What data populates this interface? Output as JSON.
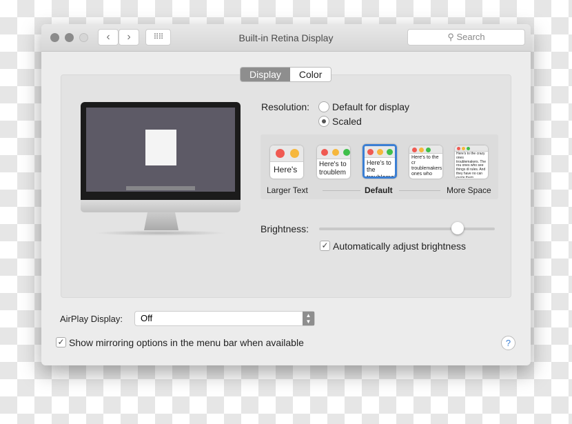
{
  "window": {
    "title": "Built-in Retina Display",
    "search_placeholder": "Search"
  },
  "tabs": [
    {
      "label": "Display",
      "selected": true
    },
    {
      "label": "Color",
      "selected": false
    }
  ],
  "resolution": {
    "label": "Resolution:",
    "options": [
      {
        "label": "Default for display",
        "selected": false
      },
      {
        "label": "Scaled",
        "selected": true
      }
    ]
  },
  "scaled_options": [
    {
      "preview": "Here's",
      "selected": false
    },
    {
      "preview": "Here's to troublem",
      "selected": false
    },
    {
      "preview": "Here's to the troublemak ones who",
      "selected": true
    },
    {
      "preview": "Here's to the cr troublemakers. ones who see t rules. And they",
      "selected": false
    },
    {
      "preview": "Here's to the crazy ones troublemakers. The rou ones who see things di rules. And they have no can quote them, disagre them. About the only th Because they change th",
      "selected": false
    }
  ],
  "scale_labels": {
    "left": "Larger Text",
    "middle": "Default",
    "right": "More Space"
  },
  "brightness": {
    "label": "Brightness:",
    "value": 0.79
  },
  "auto_brightness": {
    "label": "Automatically adjust brightness",
    "checked": true
  },
  "airplay": {
    "label": "AirPlay Display:",
    "value": "Off"
  },
  "mirroring": {
    "label": "Show mirroring options in the menu bar when available",
    "checked": true
  },
  "help_label": "?",
  "colors": {
    "accent": "#3b7fd4",
    "close": "#8a8a8a"
  }
}
